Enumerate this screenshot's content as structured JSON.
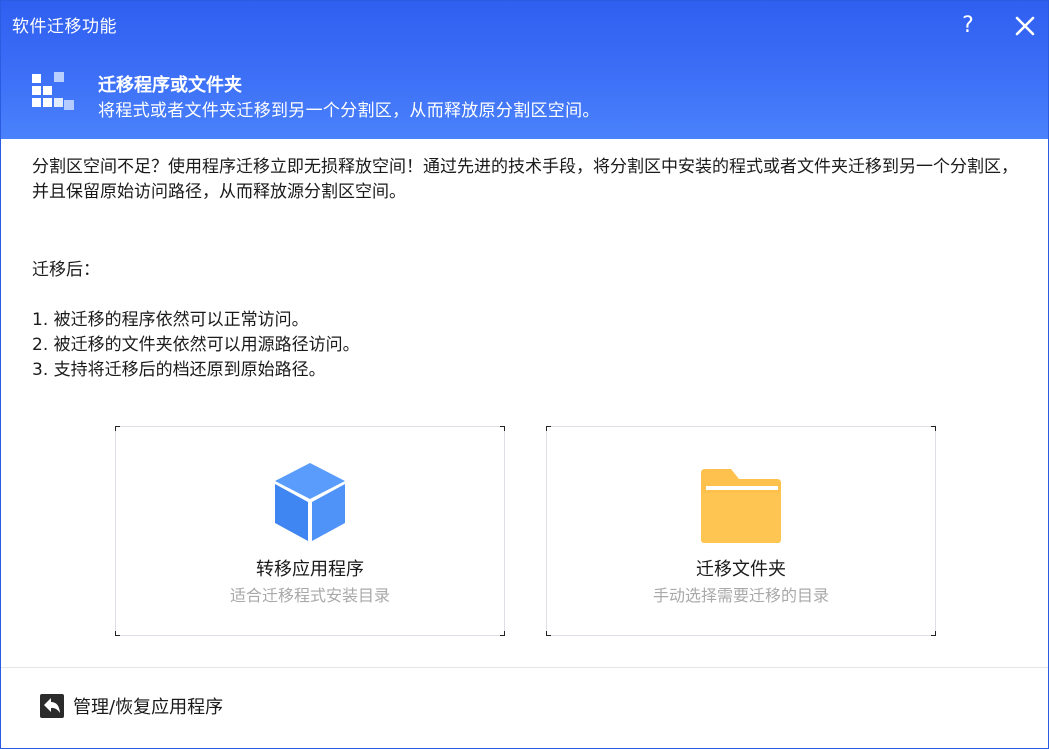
{
  "window": {
    "title": "软件迁移功能",
    "help_label": "?"
  },
  "banner": {
    "title": "迁移程序或文件夹",
    "subtitle": "将程式或者文件夹迁移到另一个分割区，从而释放原分割区空间。"
  },
  "description": {
    "intro": "分割区空间不足？使用程序迁移立即无损释放空间！通过先进的技术手段，将分割区中安装的程式或者文件夹迁移到另一个分割区，并且保留原始访问路径，从而释放源分割区空间。",
    "after_label": "迁移后：",
    "points": [
      "1. 被迁移的程序依然可以正常访问。",
      "2. 被迁移的文件夹依然可以用源路径访问。",
      "3. 支持将迁移后的档还原到原始路径。"
    ]
  },
  "cards": [
    {
      "title": "转移应用程序",
      "subtitle": "适合迁移程式安装目录",
      "icon": "cube-icon"
    },
    {
      "title": "迁移文件夹",
      "subtitle": "手动选择需要迁移的目录",
      "icon": "folder-icon"
    }
  ],
  "footer": {
    "manage_label": "管理/恢复应用程序",
    "icon": "back-arrow-icon"
  },
  "colors": {
    "header_blue": "#2f5ff0",
    "cube_blue": "#4a8df6",
    "folder_yellow": "#ffc14d",
    "muted_text": "#a9a9a9"
  }
}
